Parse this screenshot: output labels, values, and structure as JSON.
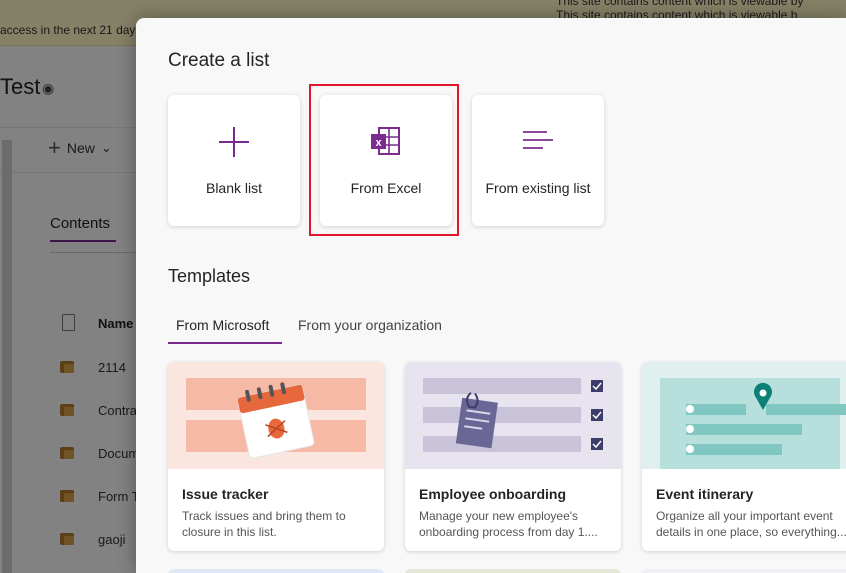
{
  "background_page": {
    "banner_text": "access in the next 21 days.",
    "banner_right_lines": [
      "This site contains content which is viewable by",
      "This site contains content which is viewable b"
    ],
    "site_title": "Test",
    "new_button": "New",
    "contents_tab": "Contents",
    "name_column": "Name",
    "rows": [
      "2114",
      "Contra",
      "Docum",
      "Form T",
      "gaoji"
    ]
  },
  "panel": {
    "title": "Create a list",
    "create_options": [
      {
        "label": "Blank list",
        "icon": "plus-icon"
      },
      {
        "label": "From Excel",
        "icon": "excel-icon"
      },
      {
        "label": "From existing list",
        "icon": "lines-icon"
      }
    ],
    "templates_title": "Templates",
    "tabs": [
      {
        "label": "From Microsoft",
        "selected": true
      },
      {
        "label": "From your organization",
        "selected": false
      }
    ],
    "templates": [
      {
        "title": "Issue tracker",
        "description": "Track issues and bring them to closure in this list.",
        "art_color": "#fbe6df"
      },
      {
        "title": "Employee onboarding",
        "description": "Manage your new employee's onboarding process from day 1....",
        "art_color": "#e8e4ef"
      },
      {
        "title": "Event itinerary",
        "description": "Organize all your important event details in one place, so everything...",
        "art_color": "#dff0ee"
      }
    ]
  },
  "colors": {
    "accent_purple": "#7b2b8e",
    "highlight_red": "#e0172b"
  }
}
